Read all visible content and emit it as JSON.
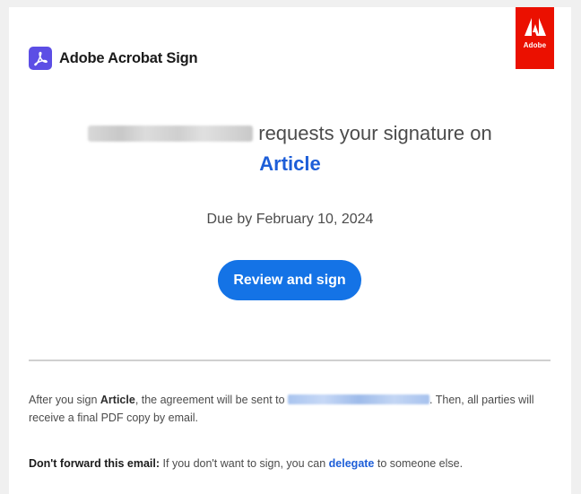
{
  "brand": {
    "name": "Adobe Acrobat Sign",
    "badge_text": "Adobe",
    "badge_color": "#eb1000",
    "logo_color": "#5c4ee5",
    "logo_icon": "acrobat-icon"
  },
  "request": {
    "text": "requests your signature on",
    "document_title": "Article"
  },
  "due": {
    "text": "Due by February 10, 2024"
  },
  "cta": {
    "label": "Review and sign",
    "color": "#1473e6"
  },
  "info": {
    "part1": "After you sign ",
    "doc": "Article",
    "part2": ", the agreement will be sent to ",
    "part3": ". Then, all parties will receive a final PDF copy by email."
  },
  "warning": {
    "bold": "Don't forward this email:",
    "part1": " If you don't want to sign, you can ",
    "link": "delegate",
    "part2": " to someone else."
  },
  "accent_color": "#1d5ed8"
}
